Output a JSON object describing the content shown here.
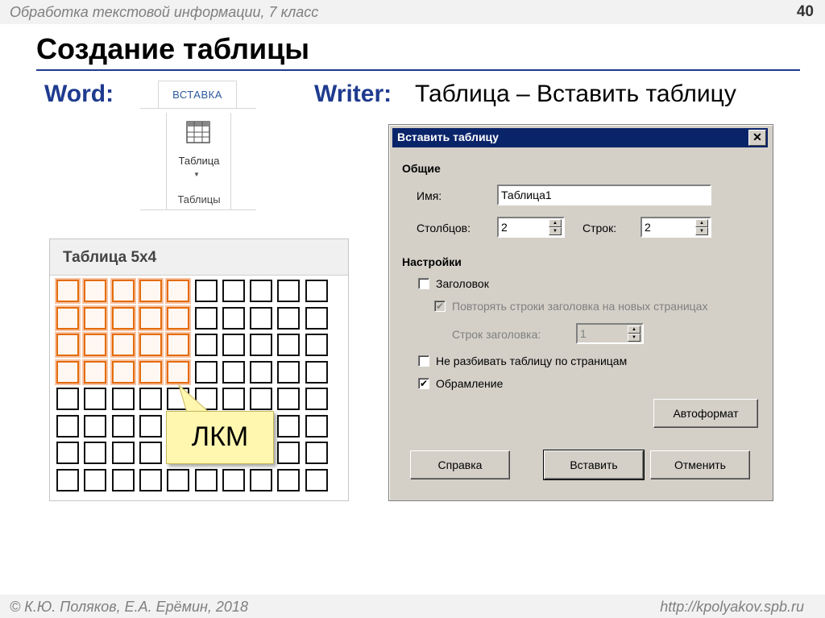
{
  "header": {
    "course": "Обработка текстовой информации, 7 класс",
    "slide_number": "40"
  },
  "title": "Создание таблицы",
  "labels": {
    "word": "Word:",
    "writer": "Writer:",
    "writer_path": "Таблица – Вставить таблицу"
  },
  "word_ribbon": {
    "tab": "ВСТАВКА",
    "button": "Таблица",
    "group": "Таблицы"
  },
  "grid_picker": {
    "title": "Таблица 5x4",
    "columns": 10,
    "rows": 8,
    "selected_columns": 5,
    "selected_rows": 4,
    "callout": "ЛКМ"
  },
  "dialog": {
    "title": "Вставить таблицу",
    "section_general": "Общие",
    "name_label": "Имя:",
    "name_value": "Таблица1",
    "columns_label": "Столбцов:",
    "columns_value": "2",
    "rows_label": "Строк:",
    "rows_value": "2",
    "section_settings": "Настройки",
    "heading_label": "Заголовок",
    "repeat_heading_label": "Повторять строки заголовка на новых страницах",
    "heading_rows_label": "Строк заголовка:",
    "heading_rows_value": "1",
    "no_split_label": "Не разбивать таблицу по страницам",
    "border_label": "Обрамление",
    "autoformat_button": "Автоформат",
    "help_button": "Справка",
    "insert_button": "Вставить",
    "cancel_button": "Отменить",
    "checkmark": "✔",
    "close_glyph": "✕"
  },
  "footer": {
    "authors": "© К.Ю. Поляков, Е.А. Ерёмин, 2018",
    "url": "http://kpolyakov.spb.ru"
  },
  "colors": {
    "accent": "#1f3b8f",
    "selection": "#e46c0a",
    "titlebar": "#0a246a"
  }
}
